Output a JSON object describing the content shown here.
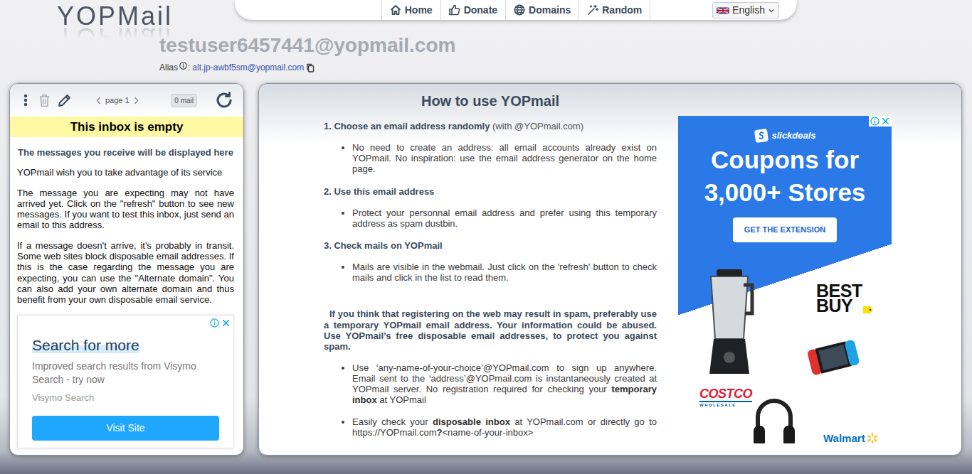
{
  "logo": {
    "text": "YOPMail"
  },
  "nav": {
    "items": [
      {
        "label": "Home"
      },
      {
        "label": "Donate"
      },
      {
        "label": "Domains"
      },
      {
        "label": "Random"
      }
    ],
    "language": "English"
  },
  "inbox": {
    "address": "testuser6457441@yopmail.com",
    "alias_label": "Alias",
    "alias_separator": ":",
    "alias": "alt.jp-awbf5sm@yopmail.com"
  },
  "toolbar": {
    "delete_disabled": true,
    "page": "page 1",
    "count": "0 mail"
  },
  "inbox_panel": {
    "banner": "This inbox is empty",
    "intro": "The messages you receive will be displayed here",
    "paragraphs": [
      "YOPmail wish you to take advantage of its service",
      "The message you are expecting may not have arrived yet. Click on the \"refresh\" button to see new messages. If you want to test this inbox, just send an email to this address.",
      "If a message doesn't arrive, it's probably in transit. Some web sites block disposable email addresses. If this is the case regarding the message you are expecting, you can use the \"Alternate domain\". You can also add your own alternate domain and thus benefit from your own disposable email service."
    ]
  },
  "side_ad": {
    "title": "Search for more",
    "description": "Improved search results from Visymo Search - try now",
    "advertiser": "Visymo Search",
    "button": "Visit Site"
  },
  "help": {
    "title": "How to use YOPmail",
    "steps": [
      {
        "heading": [
          {
            "text": "1. Choose an email address randomly",
            "bold": true
          },
          {
            "text": " (with @YOPmail.com)",
            "bold": false
          }
        ],
        "bullets": [
          [
            {
              "text": "No need to create an address: all email accounts already exist on YOPmail. No inspiration: use the email address generator on the home page.",
              "bold": false
            }
          ]
        ]
      },
      {
        "heading": [
          {
            "text": "2. Use this email address",
            "bold": true
          }
        ],
        "bullets": [
          [
            {
              "text": "Protect your personnal email address and prefer using this temporary address as spam dustbin.",
              "bold": false
            }
          ]
        ]
      },
      {
        "heading": [
          {
            "text": "3. Check mails on YOPmail",
            "bold": true
          }
        ],
        "bullets": [
          [
            {
              "text": "Mails are visible in the webmail. Just click on the 'refresh' button to check mails and click in the list to read them.",
              "bold": false
            }
          ]
        ]
      }
    ],
    "notice": "If you think that registering on the web may result in spam, preferably use a temporary YOPmail email address. Your information could be abused. Use YOPmail’s free disposable email addresses, to protect you against spam.",
    "notice_bullets": [
      [
        {
          "text": "Use ‘any-name-of-your-choice’@YOPmail.com to sign up anywhere. Email sent to the ‘address’@YOPmail.com is instantaneously created at YOPmail server. No registration required for checking your ",
          "bold": false
        },
        {
          "text": "temporary inbox",
          "bold": true
        },
        {
          "text": " at YOPmail",
          "bold": false
        }
      ],
      [
        {
          "text": "Easily check your ",
          "bold": false
        },
        {
          "text": "disposable inbox",
          "bold": true
        },
        {
          "text": " at YOPmail.com or directly go to https://YOPmail.com",
          "bold": false
        },
        {
          "text": "?",
          "bold": true
        },
        {
          "text": "<name-of-your-inbox>",
          "bold": false
        }
      ]
    ]
  },
  "promo_ad": {
    "logo": "slickdeals",
    "headline": [
      "Coupons for",
      "3,000+ Stores"
    ],
    "button": "GET THE EXTENSION",
    "brands": [
      {
        "kind": "bestbuy",
        "name": "BEST BUY"
      },
      {
        "kind": "costco",
        "name": "COSTCO",
        "sub": "WHOLESALE"
      },
      {
        "kind": "walmart",
        "name": "Walmart"
      }
    ]
  }
}
